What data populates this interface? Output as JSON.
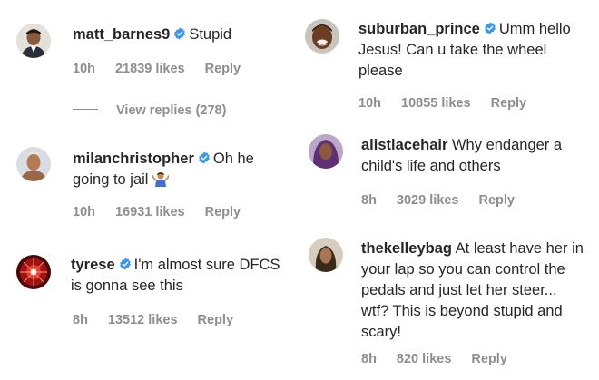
{
  "colors": {
    "text": "#262626",
    "meta": "#8e8e8e",
    "verified": "#3897f0"
  },
  "comments": [
    {
      "username": "matt_barnes9",
      "verified": true,
      "text": "Stupid",
      "time": "10h",
      "likes": "21839 likes",
      "reply": "Reply",
      "view_replies": "View replies (278)"
    },
    {
      "username": "milanchristopher",
      "verified": true,
      "text": "Oh he going to jail",
      "emoji": "person-shrugging-emoji",
      "time": "10h",
      "likes": "16931 likes",
      "reply": "Reply"
    },
    {
      "username": "tyrese",
      "verified": true,
      "text": "I'm almost sure DFCS is gonna see this",
      "time": "8h",
      "likes": "13512 likes",
      "reply": "Reply"
    },
    {
      "username": "suburban_prince",
      "verified": true,
      "text": "Umm hello Jesus! Can u take the wheel please",
      "time": "10h",
      "likes": "10855 likes",
      "reply": "Reply"
    },
    {
      "username": "alistlacehair",
      "verified": false,
      "text": "Why endanger a child's life and others",
      "time": "8h",
      "likes": "3029 likes",
      "reply": "Reply"
    },
    {
      "username": "thekelleybag",
      "verified": false,
      "text": "At least have her in your lap so you can control the pedals and just let her steer... wtf? This is beyond stupid and scary!",
      "time": "8h",
      "likes": "820 likes",
      "reply": "Reply"
    }
  ]
}
